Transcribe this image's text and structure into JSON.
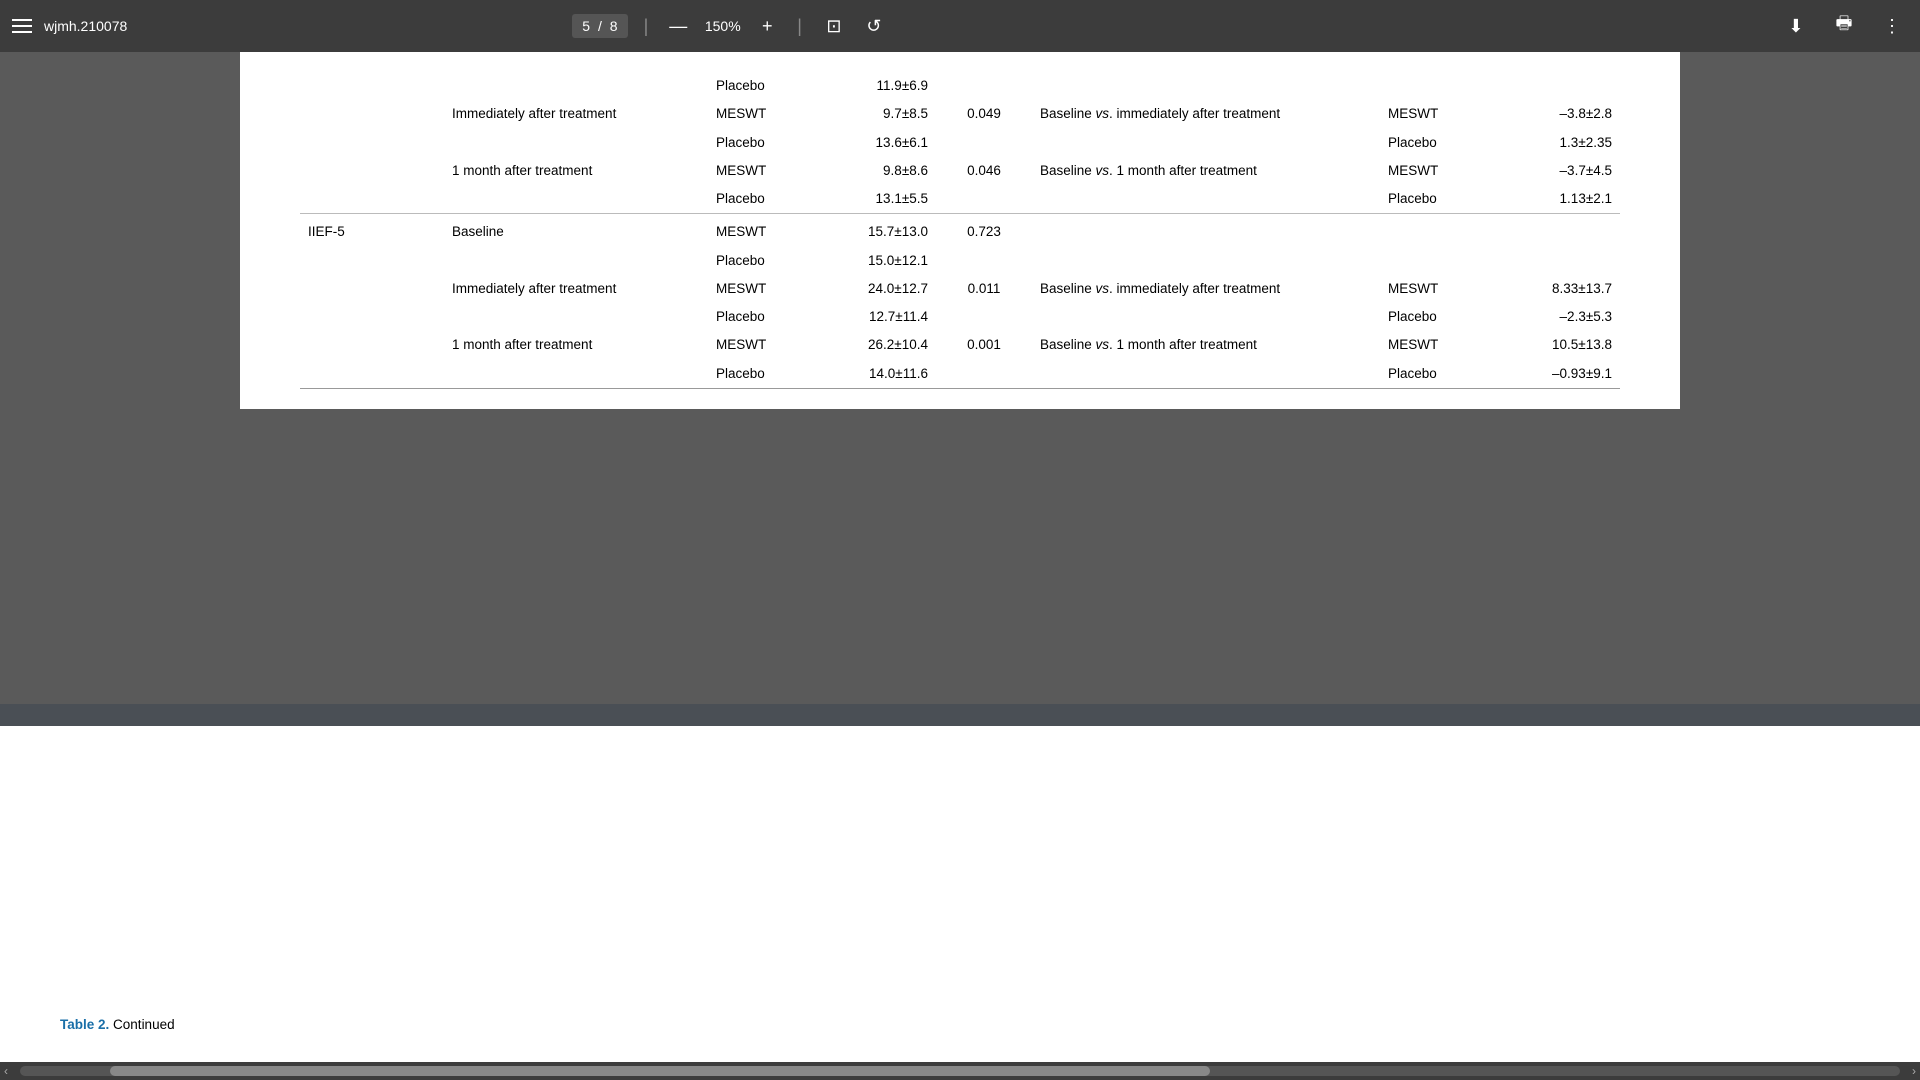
{
  "toolbar": {
    "title": "wjmh.210078",
    "page_current": "5",
    "page_total": "8",
    "zoom": "150%",
    "hamburger_label": "menu",
    "download_icon": "⬇",
    "print_icon": "🖶",
    "more_icon": "⋮",
    "zoom_out_icon": "—",
    "zoom_in_icon": "+",
    "fit_icon": "⊡",
    "rotate_icon": "↺"
  },
  "table": {
    "caption_label": "Table 2.",
    "caption_text": "Continued",
    "rows": [
      {
        "outcome": "",
        "timepoint": "",
        "group": "Placebo",
        "value": "11.9±6.9",
        "pvalue": "",
        "comparison": "",
        "comp_group": "",
        "change": ""
      },
      {
        "outcome": "",
        "timepoint": "Immediately after treatment",
        "group": "MESWT",
        "value": "9.7±8.5",
        "pvalue": "0.049",
        "comparison": "Baseline vs. immediately after treatment",
        "comp_group": "MESWT",
        "change": "–3.8±2.8"
      },
      {
        "outcome": "",
        "timepoint": "",
        "group": "Placebo",
        "value": "13.6±6.1",
        "pvalue": "",
        "comparison": "",
        "comp_group": "Placebo",
        "change": "1.3±2.35"
      },
      {
        "outcome": "",
        "timepoint": "1 month after treatment",
        "group": "MESWT",
        "value": "9.8±8.6",
        "pvalue": "0.046",
        "comparison": "Baseline vs. 1 month after treatment",
        "comp_group": "MESWT",
        "change": "–3.7±4.5"
      },
      {
        "outcome": "",
        "timepoint": "",
        "group": "Placebo",
        "value": "13.1±5.5",
        "pvalue": "",
        "comparison": "",
        "comp_group": "Placebo",
        "change": "1.13±2.1"
      },
      {
        "outcome": "IIEF-5",
        "timepoint": "Baseline",
        "group": "MESWT",
        "value": "15.7±13.0",
        "pvalue": "0.723",
        "comparison": "",
        "comp_group": "",
        "change": ""
      },
      {
        "outcome": "",
        "timepoint": "",
        "group": "Placebo",
        "value": "15.0±12.1",
        "pvalue": "",
        "comparison": "",
        "comp_group": "",
        "change": ""
      },
      {
        "outcome": "",
        "timepoint": "Immediately after treatment",
        "group": "MESWT",
        "value": "24.0±12.7",
        "pvalue": "0.011",
        "comparison": "Baseline vs. immediately after treatment",
        "comp_group": "MESWT",
        "change": "8.33±13.7"
      },
      {
        "outcome": "",
        "timepoint": "",
        "group": "Placebo",
        "value": "12.7±11.4",
        "pvalue": "",
        "comparison": "",
        "comp_group": "Placebo",
        "change": "–2.3±5.3"
      },
      {
        "outcome": "",
        "timepoint": "1 month after treatment",
        "group": "MESWT",
        "value": "26.2±10.4",
        "pvalue": "0.001",
        "comparison": "Baseline vs. 1 month after treatment",
        "comp_group": "MESWT",
        "change": "10.5±13.8"
      },
      {
        "outcome": "",
        "timepoint": "",
        "group": "Placebo",
        "value": "14.0±11.6",
        "pvalue": "",
        "comparison": "",
        "comp_group": "Placebo",
        "change": "–0.93±9.1"
      }
    ]
  }
}
